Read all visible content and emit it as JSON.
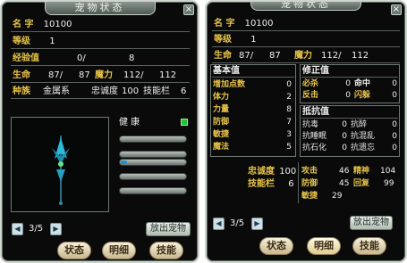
{
  "left_panel": {
    "title": "宠物状态",
    "close": "×",
    "rows": {
      "name_label": "名 字",
      "name_value": "10100",
      "level_label": "等级",
      "level_value": "1",
      "exp_label": "经验值",
      "exp_current": "0/",
      "exp_max": "8",
      "hp_label": "生命",
      "hp_value": "87/",
      "hp_max": "87",
      "mp_label": "魔力",
      "mp_value": "112/",
      "mp_max": "112",
      "race_label": "种族",
      "race_value": "金属系",
      "loyalty_label": "忠诚度",
      "loyalty_value": "100",
      "skill_slots_label": "技能栏",
      "skill_slots_value": "6"
    },
    "health_label": "健 康",
    "bars": [
      0.0,
      0.0,
      0.1,
      0.0,
      0.0
    ],
    "page": "3/5",
    "release_button": "放出宠物"
  },
  "right_panel": {
    "title": "宠物状态",
    "close": "×",
    "rows": {
      "name_label": "名 字",
      "name_value": "10100",
      "level_label": "等级",
      "level_value": "1",
      "hp_label": "生命",
      "hp_value": "87/",
      "hp_max": "87",
      "mp_label": "魔力",
      "mp_value": "112/",
      "mp_max": "112"
    },
    "base_header": "基本值",
    "base_stats": [
      {
        "label": "增加点数",
        "value": "0"
      },
      {
        "label": "体力",
        "value": "2"
      },
      {
        "label": "力量",
        "value": "8"
      },
      {
        "label": "防御",
        "value": "7"
      },
      {
        "label": "敏捷",
        "value": "3"
      },
      {
        "label": "魔法",
        "value": "5"
      }
    ],
    "correction_header": "修正值",
    "correction_stats": [
      {
        "label1": "必杀",
        "value1": "0",
        "label2": "命中",
        "value2": "0"
      },
      {
        "label1": "反击",
        "value1": "0",
        "label2": "闪躲",
        "value2": "0"
      }
    ],
    "resist_header": "抵抗值",
    "resist_stats": [
      {
        "label1": "抗毒",
        "value1": "0",
        "label2": "抗醉",
        "value2": "0"
      },
      {
        "label1": "抗睡眠",
        "value1": "0",
        "label2": "抗混乱",
        "value2": "0"
      },
      {
        "label1": "抗石化",
        "value1": "0",
        "label2": "抗遗忘",
        "value2": "0"
      }
    ],
    "loyalty_label": "忠诚度",
    "loyalty_value": "100",
    "skill_slots_label": "技能栏",
    "skill_slots_value": "6",
    "attack_label": "攻击",
    "attack_value": "46",
    "defense_label": "防御",
    "defense_value": "45",
    "agility_label": "敏捷",
    "agility_value": "29",
    "spirit_label": "精神",
    "spirit_value": "104",
    "recovery_label": "回复",
    "recovery_value": "99",
    "page": "3/5",
    "release_button": "放出宠物"
  },
  "tabs": [
    "状态",
    "明细",
    "技能"
  ]
}
